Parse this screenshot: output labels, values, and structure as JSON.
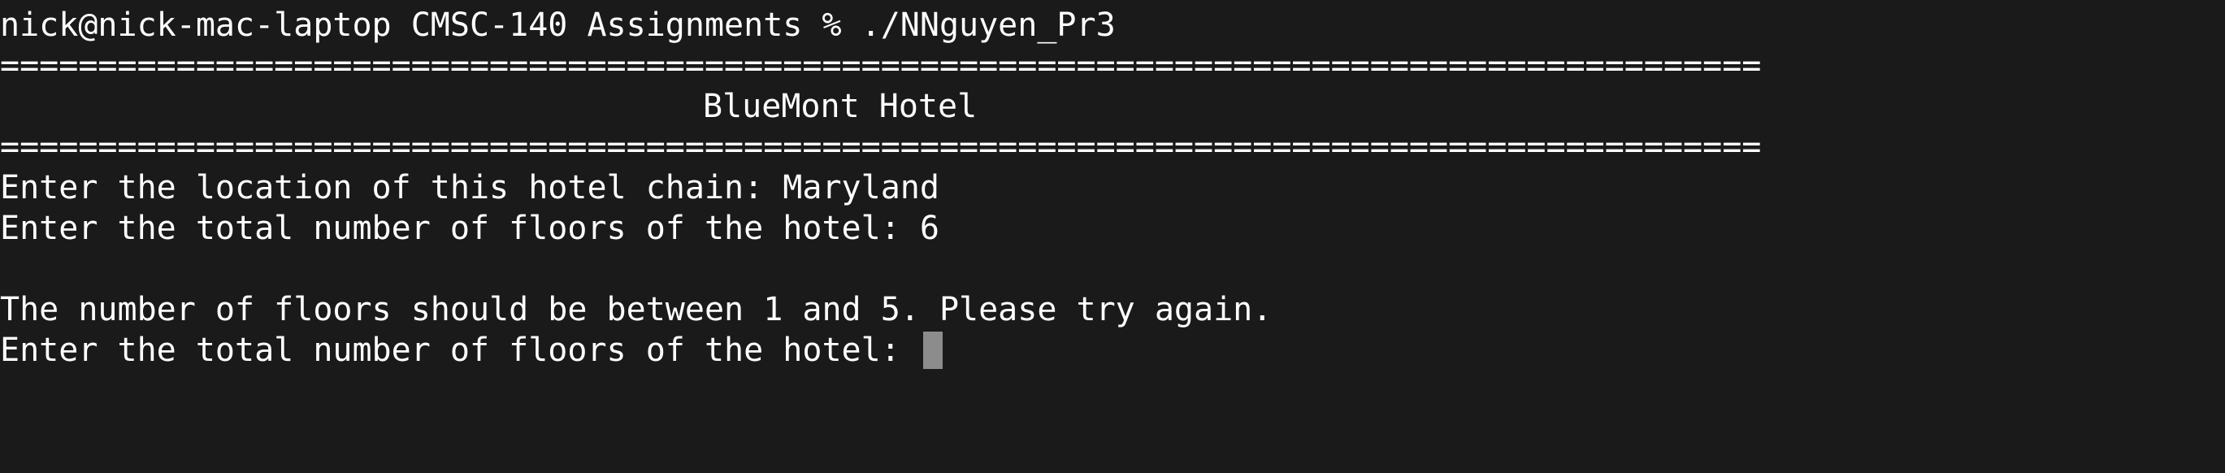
{
  "terminal": {
    "prompt": "nick@nick-mac-laptop CMSC-140 Assignments % ./NNguyen_Pr3",
    "separator": "==========================================================================================",
    "hotel_title": "BlueMont Hotel",
    "location_prompt": "Enter the location of this hotel chain: Maryland",
    "floors_prompt_1": "Enter the total number of floors of the hotel: 6",
    "error_message": "The number of floors should be between 1 and 5. Please try again.",
    "floors_prompt_2": "Enter the total number of floors of the hotel: "
  }
}
